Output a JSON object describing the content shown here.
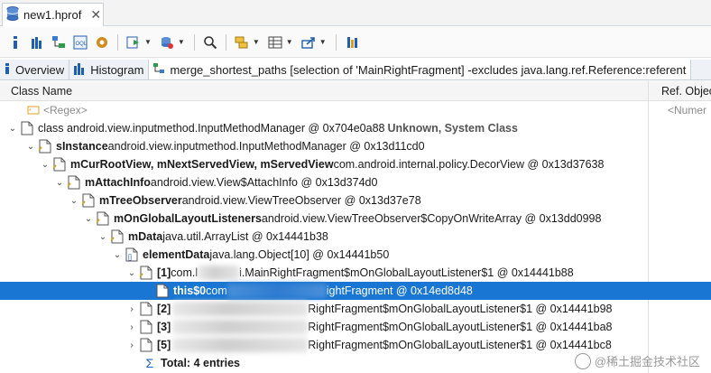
{
  "editor": {
    "file_tab": "new1.hprof",
    "close_glyph": "✕"
  },
  "toolbar": {
    "icons": [
      "info-icon",
      "histogram-icon",
      "dominator-tree-icon",
      "oql-icon",
      "heap-dump-settings-icon",
      "run-query-icon",
      "query-browser-icon",
      "search-icon",
      "group-by-icon",
      "calculate-retained-icon",
      "export-icon",
      "pin-icon"
    ]
  },
  "subtabs": {
    "overview": "Overview",
    "histogram": "Histogram",
    "query": "merge_shortest_paths [selection of 'MainRightFragment] -excludes java.lang.ref.Reference:referent"
  },
  "columns": {
    "class_name": "Class Name",
    "ref_objects": "Ref. Objec"
  },
  "filter": {
    "regex": "<Regex>",
    "numeric": "<Numer"
  },
  "tree": {
    "r0": {
      "text": "class android.view.inputmethod.InputMethodManager @ 0x704e0a88 ",
      "extra": "Unknown, System Class"
    },
    "r1": {
      "name": "sInstance",
      "text": " android.view.inputmethod.InputMethodManager @ 0x13d11cd0"
    },
    "r2": {
      "name": "mCurRootView, mNextServedView, mServedView",
      "text": " com.android.internal.policy.DecorView @ 0x13d37638"
    },
    "r3": {
      "name": "mAttachInfo",
      "text": " android.view.View$AttachInfo @ 0x13d374d0"
    },
    "r4": {
      "name": "mTreeObserver",
      "text": " android.view.ViewTreeObserver @ 0x13d37e78"
    },
    "r5": {
      "name": "mOnGlobalLayoutListeners",
      "text": " android.view.ViewTreeObserver$CopyOnWriteArray @ 0x13dd0998"
    },
    "r6": {
      "name": "mData",
      "text": " java.util.ArrayList @ 0x14441b38"
    },
    "r7": {
      "name": "elementData",
      "text": " java.lang.Object[10] @ 0x14441b50"
    },
    "r8": {
      "name": "[1]",
      "pre": " com.l",
      "text": "i.MainRightFragment$mOnGlobalLayoutListener$1 @ 0x14441b88"
    },
    "r9": {
      "name": "this$0",
      "pre": " com",
      "text": "ightFragment @ 0x14ed8d48"
    },
    "r10": {
      "name": "[2]",
      "text": "RightFragment$mOnGlobalLayoutListener$1 @ 0x14441b98"
    },
    "r11": {
      "name": "[3]",
      "text": "RightFragment$mOnGlobalLayoutListener$1 @ 0x14441ba8"
    },
    "r12": {
      "name": "[5]",
      "text": "RightFragment$mOnGlobalLayoutListener$1 @ 0x14441bc8"
    },
    "total": "Total: 4 entries"
  },
  "watermark": "@稀土掘金技术社区",
  "colors": {
    "selection": "#1976d2",
    "accent": "#1f5fb3"
  }
}
